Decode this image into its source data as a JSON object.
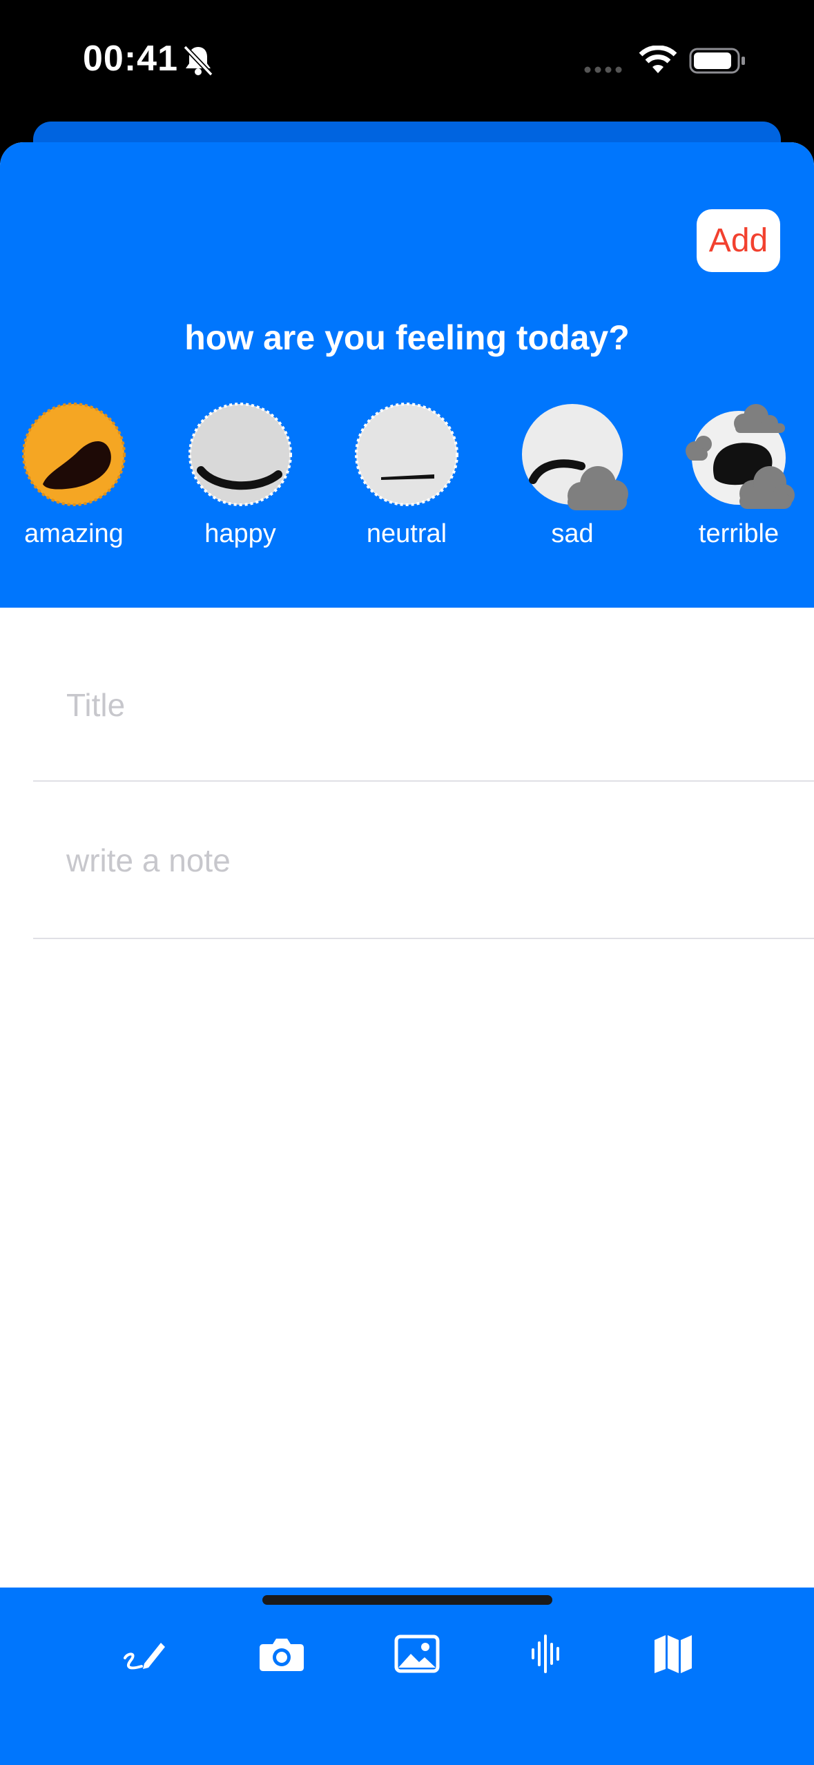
{
  "status": {
    "time": "00:41"
  },
  "header": {
    "add_label": "Add",
    "question": "how are you feeling today?"
  },
  "moods": [
    {
      "label": "amazing",
      "color": "#f5a623",
      "selected": true
    },
    {
      "label": "happy",
      "color": "#d9d9d9"
    },
    {
      "label": "neutral",
      "color": "#e4e4e4"
    },
    {
      "label": "sad",
      "color": "#ececec"
    },
    {
      "label": "terrible",
      "color": "#f0f0f0"
    }
  ],
  "form": {
    "title_placeholder": "Title",
    "note_placeholder": "write a note"
  },
  "toolbar": {
    "items": [
      "handwriting-icon",
      "camera-icon",
      "photo-icon",
      "waveform-icon",
      "map-icon"
    ]
  },
  "colors": {
    "accent": "#0076fd",
    "add_text": "#f2412f"
  }
}
